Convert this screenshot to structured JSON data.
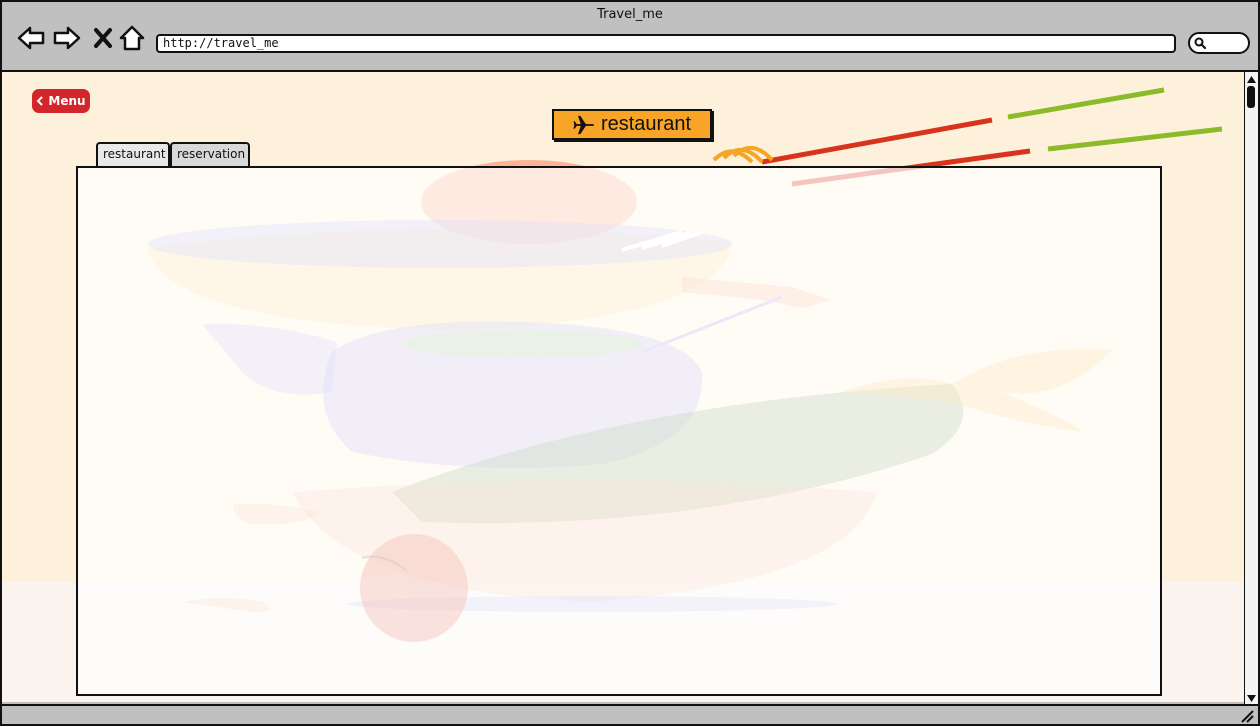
{
  "window": {
    "title": "Travel_me"
  },
  "toolbar": {
    "back_icon": "arrow-left-icon",
    "forward_icon": "arrow-right-icon",
    "stop_icon": "close-icon",
    "home_icon": "home-icon",
    "address": "http://travel_me",
    "search_icon": "search-icon"
  },
  "page": {
    "menu_label": "Menu",
    "title": "restaurant",
    "title_icon": "airplane-icon",
    "tabs": [
      {
        "label": "restaurant",
        "active": true
      },
      {
        "label": "reservation",
        "active": false
      }
    ]
  },
  "colors": {
    "chrome": "#c0c0c0",
    "menu_button": "#d3262a",
    "title_badge": "#f7a427",
    "background": "#fdf1dc"
  }
}
